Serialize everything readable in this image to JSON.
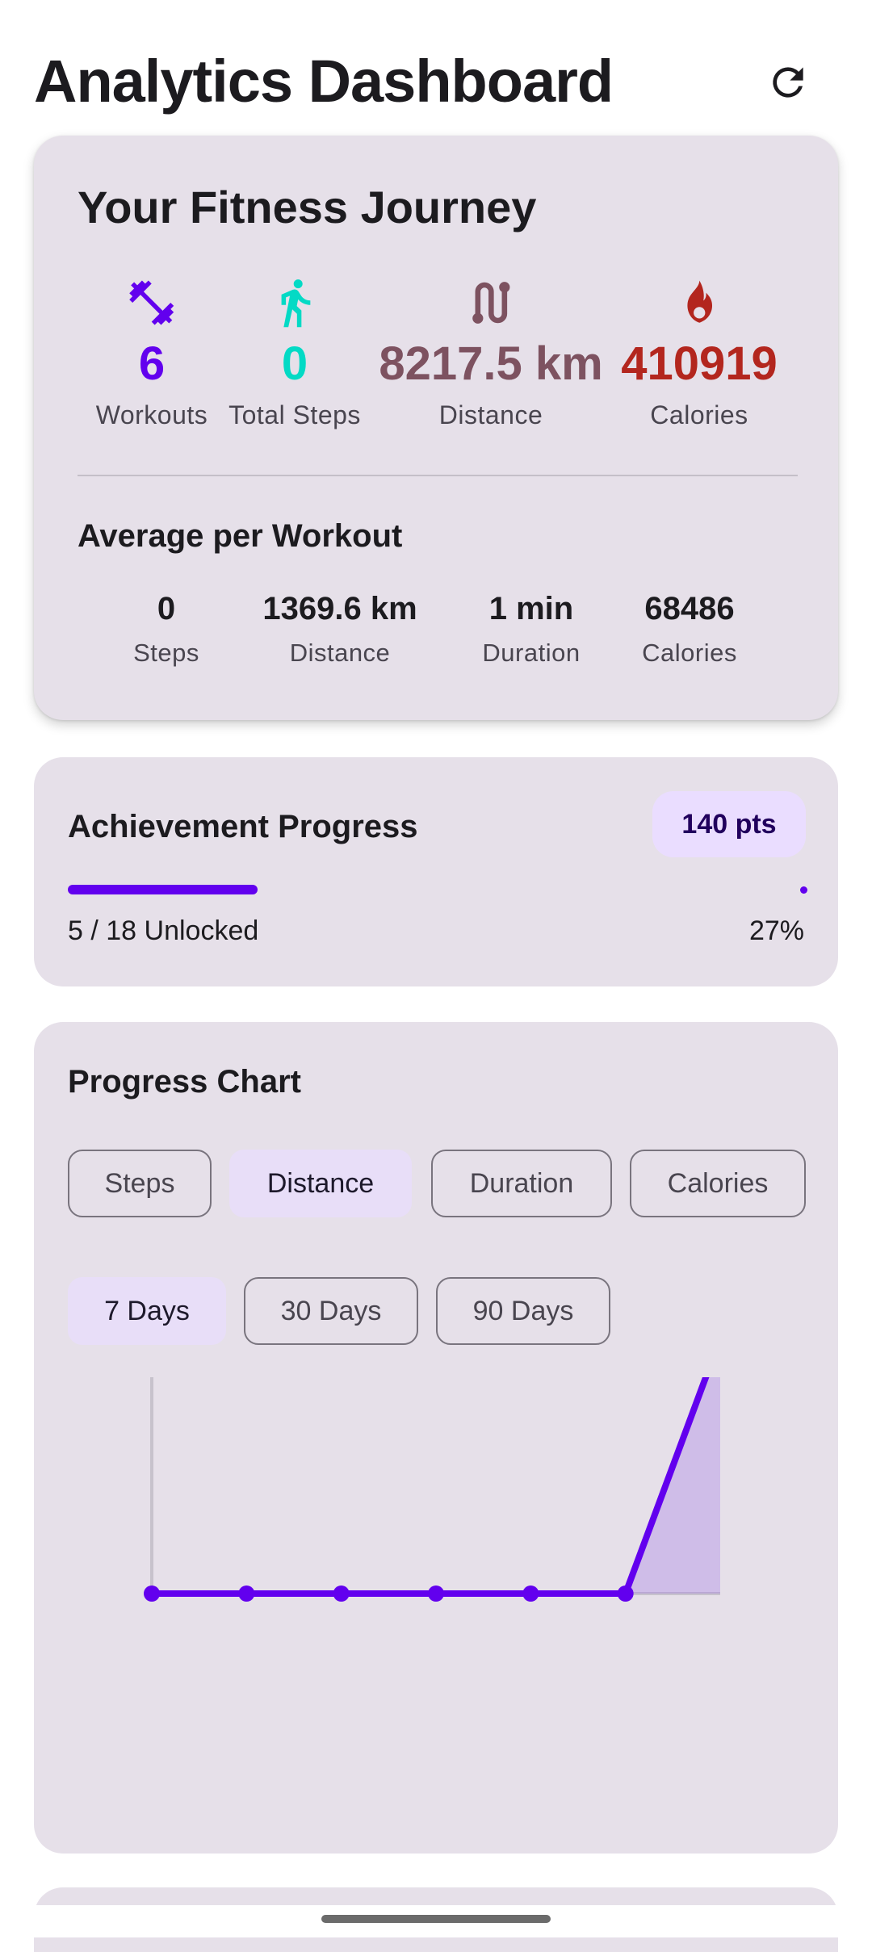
{
  "app_bar": {
    "title": "Analytics Dashboard",
    "refresh_icon": "refresh-icon"
  },
  "fitness_journey": {
    "title": "Your Fitness Journey",
    "stats": [
      {
        "icon": "dumbbell-icon",
        "value": "6",
        "label": "Workouts",
        "color": "#6200ee"
      },
      {
        "icon": "walking-icon",
        "value": "0",
        "label": "Total Steps",
        "color": "#03dac5"
      },
      {
        "icon": "route-icon",
        "value": "8217.5 km",
        "label": "Distance",
        "color": "#7d5260"
      },
      {
        "icon": "fire-icon",
        "value": "410919",
        "label": "Calories",
        "color": "#b3261e"
      }
    ],
    "average": {
      "title": "Average per Workout",
      "items": [
        {
          "value": "0",
          "label": "Steps"
        },
        {
          "value": "1369.6 km",
          "label": "Distance"
        },
        {
          "value": "1 min",
          "label": "Duration"
        },
        {
          "value": "68486",
          "label": "Calories"
        }
      ]
    }
  },
  "achievements": {
    "title": "Achievement Progress",
    "points": "140 pts",
    "unlocked": "5 / 18 Unlocked",
    "percent": "27%",
    "progress": 0.27
  },
  "progress_chart": {
    "title": "Progress Chart",
    "metric_chips": [
      {
        "label": "Steps",
        "selected": false
      },
      {
        "label": "Distance",
        "selected": true
      },
      {
        "label": "Duration",
        "selected": false
      },
      {
        "label": "Calories",
        "selected": false
      }
    ],
    "range_chips": [
      {
        "label": "7 Days",
        "selected": true
      },
      {
        "label": "30 Days",
        "selected": false
      },
      {
        "label": "90 Days",
        "selected": false
      }
    ]
  },
  "chart_data": {
    "type": "area",
    "x": [
      1,
      2,
      3,
      4,
      5,
      6,
      7
    ],
    "values": [
      0,
      0,
      0,
      0,
      0,
      0,
      1
    ],
    "ylim": [
      0,
      1
    ],
    "grid": false,
    "color": "#6200ee"
  }
}
